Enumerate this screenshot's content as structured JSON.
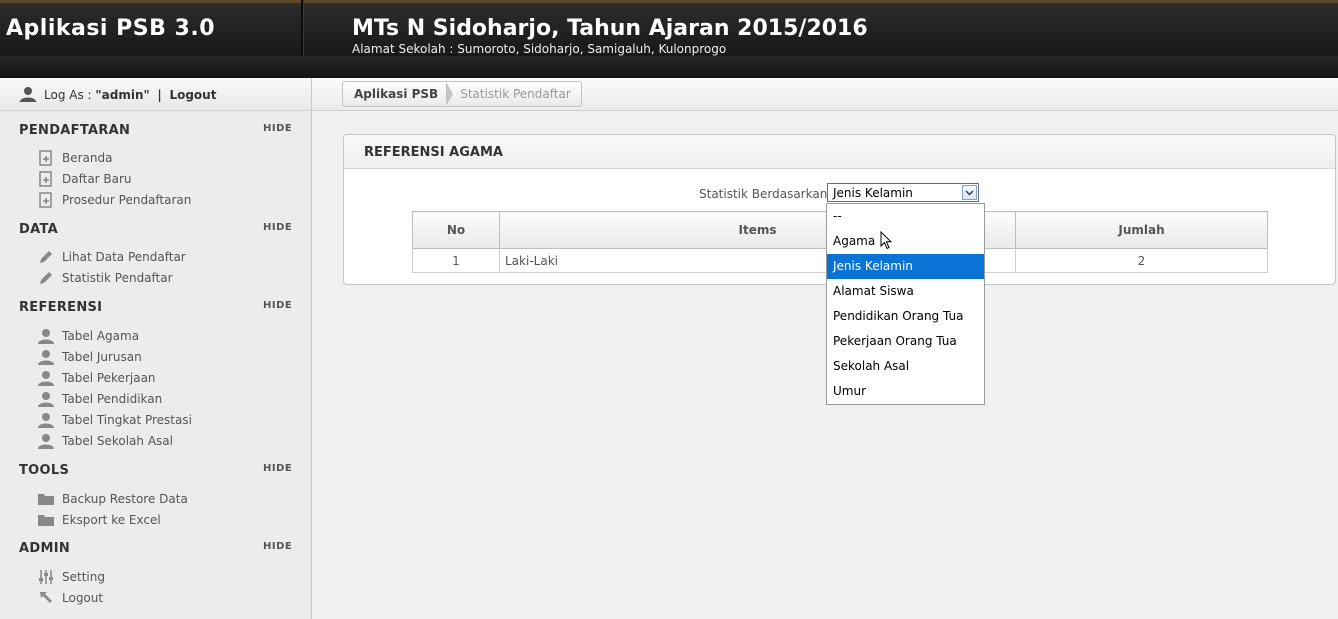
{
  "header": {
    "app_title": "Aplikasi PSB 3.0",
    "school_title": "MTs N Sidoharjo, Tahun Ajaran 2015/2016",
    "school_address": "Alamat Sekolah : Sumoroto, Sidoharjo, Samigaluh, Kulonprogo"
  },
  "session": {
    "login_prefix": "Log As :",
    "username": "\"admin\"",
    "separator": "|",
    "logout_label": "Logout"
  },
  "sidebar": {
    "hide_label": "HIDE",
    "sections": [
      {
        "title": "PENDAFTARAN",
        "items": [
          "Beranda",
          "Daftar Baru",
          "Prosedur Pendaftaran"
        ]
      },
      {
        "title": "DATA",
        "items": [
          "Lihat Data Pendaftar",
          "Statistik Pendaftar"
        ]
      },
      {
        "title": "REFERENSI",
        "items": [
          "Tabel Agama",
          "Tabel Jurusan",
          "Tabel Pekerjaan",
          "Tabel Pendidikan",
          "Tabel Tingkat Prestasi",
          "Tabel Sekolah Asal"
        ]
      },
      {
        "title": "TOOLS",
        "items": [
          "Backup Restore Data",
          "Eksport ke Excel"
        ]
      },
      {
        "title": "ADMIN",
        "items": [
          "Setting",
          "Logout"
        ]
      }
    ]
  },
  "breadcrumb": [
    "Aplikasi PSB",
    "Statistik Pendaftar"
  ],
  "panel": {
    "title": "REFERENSI AGAMA",
    "filter_label": "Statistik Berdasarkan",
    "filter_value": "Jenis Kelamin",
    "options": [
      "--",
      "Agama",
      "Jenis Kelamin",
      "Alamat Siswa",
      "Pendidikan Orang Tua",
      "Pekerjaan Orang Tua",
      "Sekolah Asal",
      "Umur"
    ],
    "selected_index": 2
  },
  "table": {
    "headers": [
      "No",
      "Items",
      "Jumlah"
    ],
    "rows": [
      {
        "no": "1",
        "item": "Laki-Laki",
        "jumlah": "2"
      }
    ]
  },
  "colors": {
    "selection": "#0a74d6",
    "header_bg": "#1f1f1f"
  }
}
